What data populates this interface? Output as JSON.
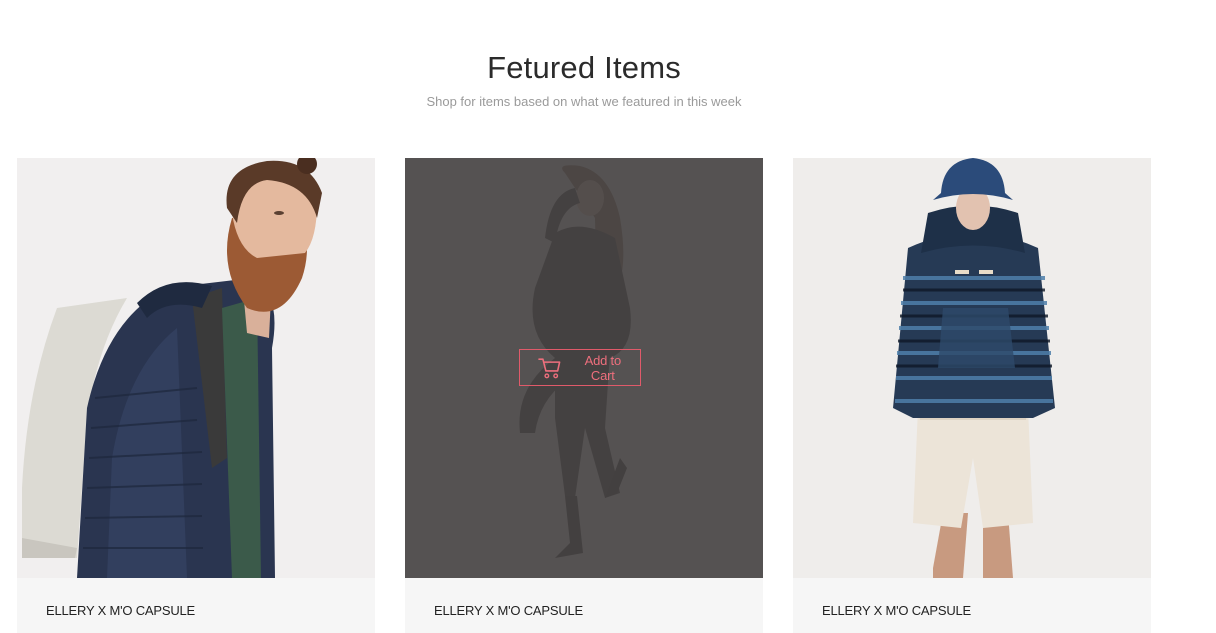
{
  "section": {
    "title": "Fetured Items",
    "subtitle": "Shop for items based on what we featured in this week"
  },
  "products": [
    {
      "name": "ELLERY X M'O CAPSULE",
      "image": "man-with-beard-blue-puffer-jacket-backpack"
    },
    {
      "name": "ELLERY X M'O CAPSULE",
      "image": "woman-black-suit-heels",
      "hover_action": "Add to Cart"
    },
    {
      "name": "ELLERY X M'O CAPSULE",
      "image": "man-striped-hoodie-bucket-hat-shorts"
    }
  ],
  "colors": {
    "accent": "#ee6f7d",
    "overlay": "#484444",
    "card_footer": "#f6f6f6"
  },
  "icons": {
    "cart": "shopping-cart-icon"
  }
}
